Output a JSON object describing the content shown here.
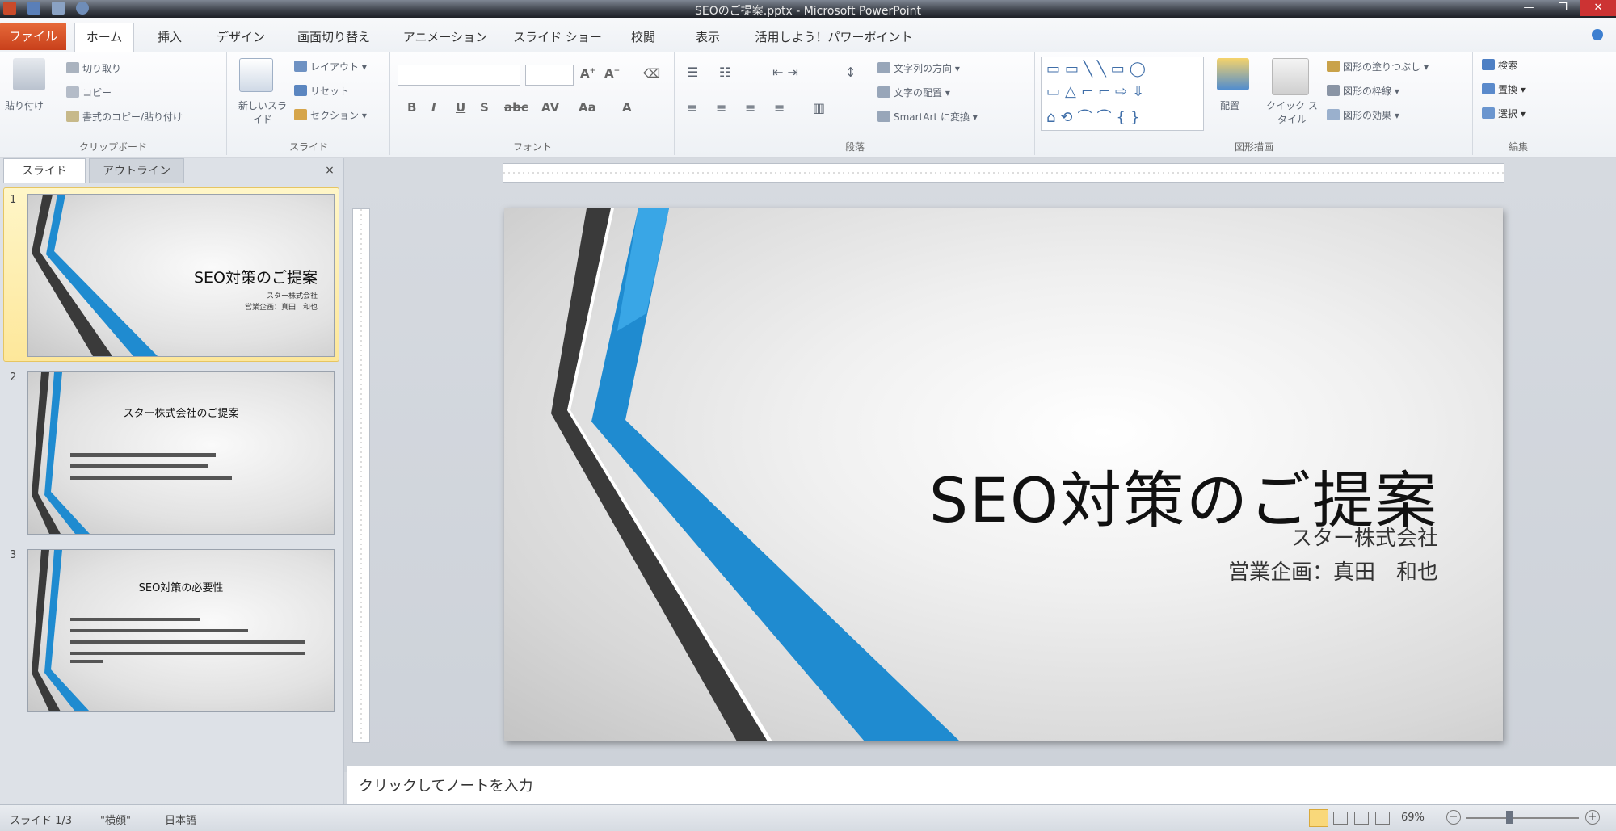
{
  "window": {
    "title": "SEOのご提案.pptx - Microsoft PowerPoint"
  },
  "tabs": [
    {
      "label": "ファイル"
    },
    {
      "label": "ホーム"
    },
    {
      "label": "挿入"
    },
    {
      "label": "デザイン"
    },
    {
      "label": "画面切り替え"
    },
    {
      "label": "アニメーション"
    },
    {
      "label": "スライド ショー"
    },
    {
      "label": "校閲"
    },
    {
      "label": "表示"
    },
    {
      "label": "活用しよう！パワーポイント"
    }
  ],
  "ribbon": {
    "clipboard": {
      "paste": "貼り付け",
      "cut": "切り取り",
      "copy": "コピー",
      "format_painter": "書式のコピー/貼り付け",
      "label": "クリップボード"
    },
    "slides": {
      "new_slide": "新しいスライド",
      "layout": "レイアウト",
      "reset": "リセット",
      "section": "セクション",
      "label": "スライド"
    },
    "font": {
      "label": "フォント"
    },
    "paragraph": {
      "text_direction": "文字列の方向",
      "align_text": "文字の配置",
      "smartart": "SmartArt に変換",
      "label": "段落"
    },
    "drawing": {
      "arrange": "配置",
      "quick_styles": "クイック スタイル",
      "shape_fill": "図形の塗りつぶし",
      "shape_outline": "図形の枠線",
      "shape_effects": "図形の効果",
      "label": "図形描画"
    },
    "editing": {
      "find": "検索",
      "replace": "置換",
      "select": "選択",
      "label": "編集"
    }
  },
  "pane": {
    "tab_slides": "スライド",
    "tab_outline": "アウトライン",
    "close": "×"
  },
  "thumbnails": [
    {
      "num": "1",
      "title": "SEO対策のご提案",
      "lines": [
        "スター株式会社",
        "営業企画：真田　和也"
      ]
    },
    {
      "num": "2",
      "title": "スター株式会社のご提案",
      "lines": [
        "",
        "",
        ""
      ]
    },
    {
      "num": "3",
      "title": "SEO対策の必要性",
      "lines": [
        "",
        "",
        "",
        "",
        ""
      ]
    }
  ],
  "slide": {
    "title": "SEO対策のご提案",
    "subtitle1": "スター株式会社",
    "subtitle2": "営業企画：真田　和也"
  },
  "notes": {
    "placeholder": "クリックしてノートを入力"
  },
  "status": {
    "slide_pos": "スライド 1/3",
    "theme": "\"横顔\"",
    "language": "日本語",
    "zoom": "69%"
  },
  "colors": {
    "accent_blue": "#1f8bd0",
    "light_blue": "#39a6e6",
    "dark_gray": "#3a3a3a",
    "file_tab": "#d4532a"
  }
}
